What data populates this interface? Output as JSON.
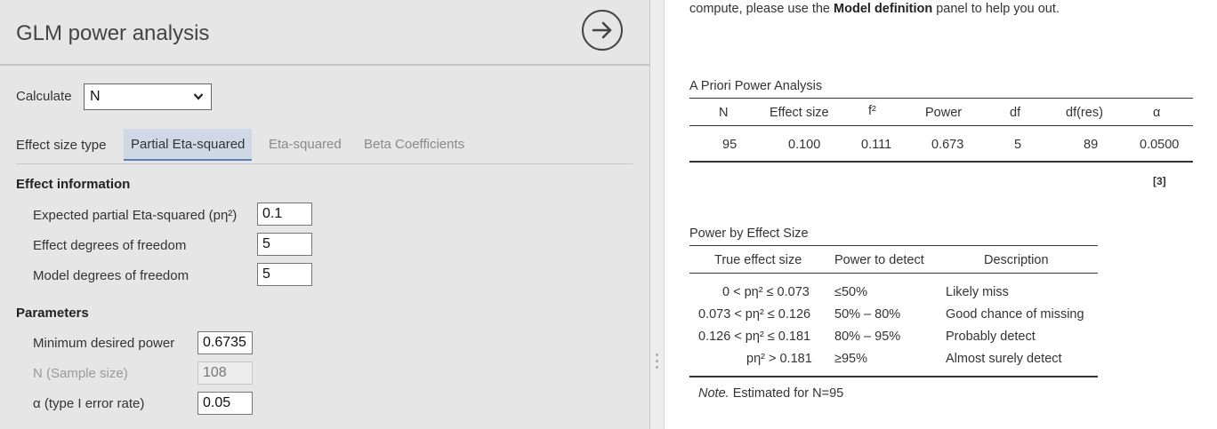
{
  "options": {
    "title": "GLM power analysis",
    "calculate_label": "Calculate",
    "calculate_value": "N",
    "effect_size_type_label": "Effect size type",
    "tabs": [
      "Partial Eta-squared",
      "Eta-squared",
      "Beta Coefficients"
    ],
    "active_tab": "Partial Eta-squared",
    "effect_info": {
      "heading": "Effect information",
      "expected_label": "Expected partial Eta-squared (pη²)",
      "expected_value": "0.1",
      "effect_df_label": "Effect degrees of freedom",
      "effect_df_value": "5",
      "model_df_label": "Model degrees of freedom",
      "model_df_value": "5"
    },
    "parameters": {
      "heading": "Parameters",
      "power_label": "Minimum desired power",
      "power_value": "0.6735",
      "n_label": "N (Sample size)",
      "n_value": "108",
      "alpha_label": "α (type I error rate)",
      "alpha_value": "0.05"
    }
  },
  "results": {
    "intro_pre": "compute, please use the ",
    "intro_bold": "Model definition",
    "intro_post": " panel to help you out.",
    "apriori": {
      "title": "A Priori Power Analysis",
      "headers": [
        "N",
        "Effect size",
        "f²",
        "Power",
        "df",
        "df(res)",
        "α"
      ],
      "row": [
        "95",
        "0.100",
        "0.111",
        "0.673",
        "5",
        "89",
        "0.0500"
      ],
      "ref": "[3]"
    },
    "power_by_effect": {
      "title": "Power by Effect Size",
      "headers": [
        "True effect size",
        "Power to detect",
        "Description"
      ],
      "rows": [
        [
          "0 < pη² ≤ 0.073",
          "≤50%",
          "Likely miss"
        ],
        [
          "0.073 < pη² ≤ 0.126",
          "50% – 80%",
          "Good chance of missing"
        ],
        [
          "0.126 < pη² ≤ 0.181",
          "80% – 95%",
          "Probably detect"
        ],
        [
          "pη² > 0.181",
          "≥95%",
          "Almost surely detect"
        ]
      ],
      "note_italic": "Note.",
      "note_text": " Estimated for N=95"
    }
  },
  "colors": {
    "panel_bg": "#e6e6e6",
    "active_tab_bg": "#d0d8e6",
    "active_tab_border": "#5b7fb5"
  }
}
